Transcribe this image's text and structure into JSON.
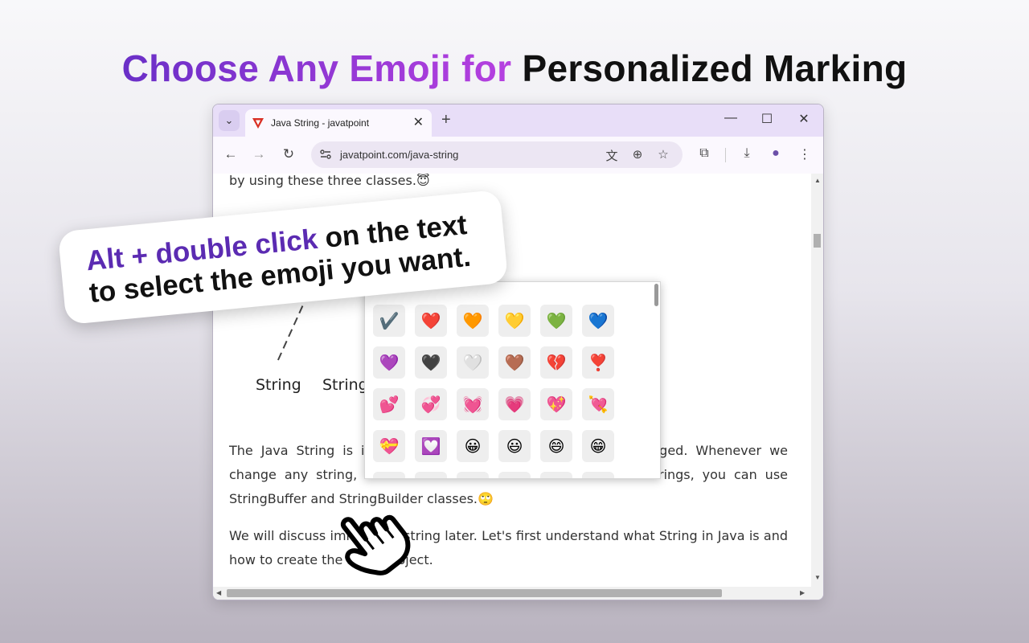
{
  "headline": {
    "accent": "Choose Any Emoji for",
    "rest": "Personalized Marking"
  },
  "browser": {
    "tab_title": "Java String - javatpoint",
    "url": "javatpoint.com/java-string",
    "new_tab": "+",
    "tab_close": "✕",
    "tab_search": "⌄",
    "controls": {
      "minimize": "—",
      "maximize": "☐",
      "close": "✕"
    },
    "nav": {
      "back": "←",
      "forward": "→",
      "reload": "↻"
    },
    "omnibox_icons": {
      "translate": "文",
      "zoom": "⊕",
      "bookmark": "☆"
    },
    "toolbar_icons": {
      "extensions": "⧉",
      "download": "⤓",
      "profile": "●",
      "menu": "⋮"
    }
  },
  "content": {
    "para1": "by using these three classes.😇",
    "diagram_labels": [
      "String",
      "String"
    ],
    "para2": "The Java String is immutable which means it cannot be changed. Whenever we change any string, a new instance is created. For mutable strings, you can use StringBuffer and StringBuilder classes.🙄",
    "para3": "We will discuss immutable string later. Let's first understand what String in Java is and how to create the String object."
  },
  "picker": {
    "emojis": [
      [
        "✔️",
        "❤️",
        "🧡",
        "💛",
        "💚",
        "💙"
      ],
      [
        "💜",
        "🖤",
        "🤍",
        "🤎",
        "💔",
        "❣️"
      ],
      [
        "💕",
        "💞",
        "💓",
        "💗",
        "💖",
        "💘"
      ],
      [
        "💝",
        "💟",
        "😀",
        "😃",
        "😄",
        "😁"
      ],
      [
        "😆",
        "😅",
        "🤣",
        "😂",
        "🙂",
        "🙃"
      ]
    ]
  },
  "callout": {
    "highlight": "Alt + double click",
    "line1_rest": "on the text",
    "line2": "to select the emoji you want."
  }
}
